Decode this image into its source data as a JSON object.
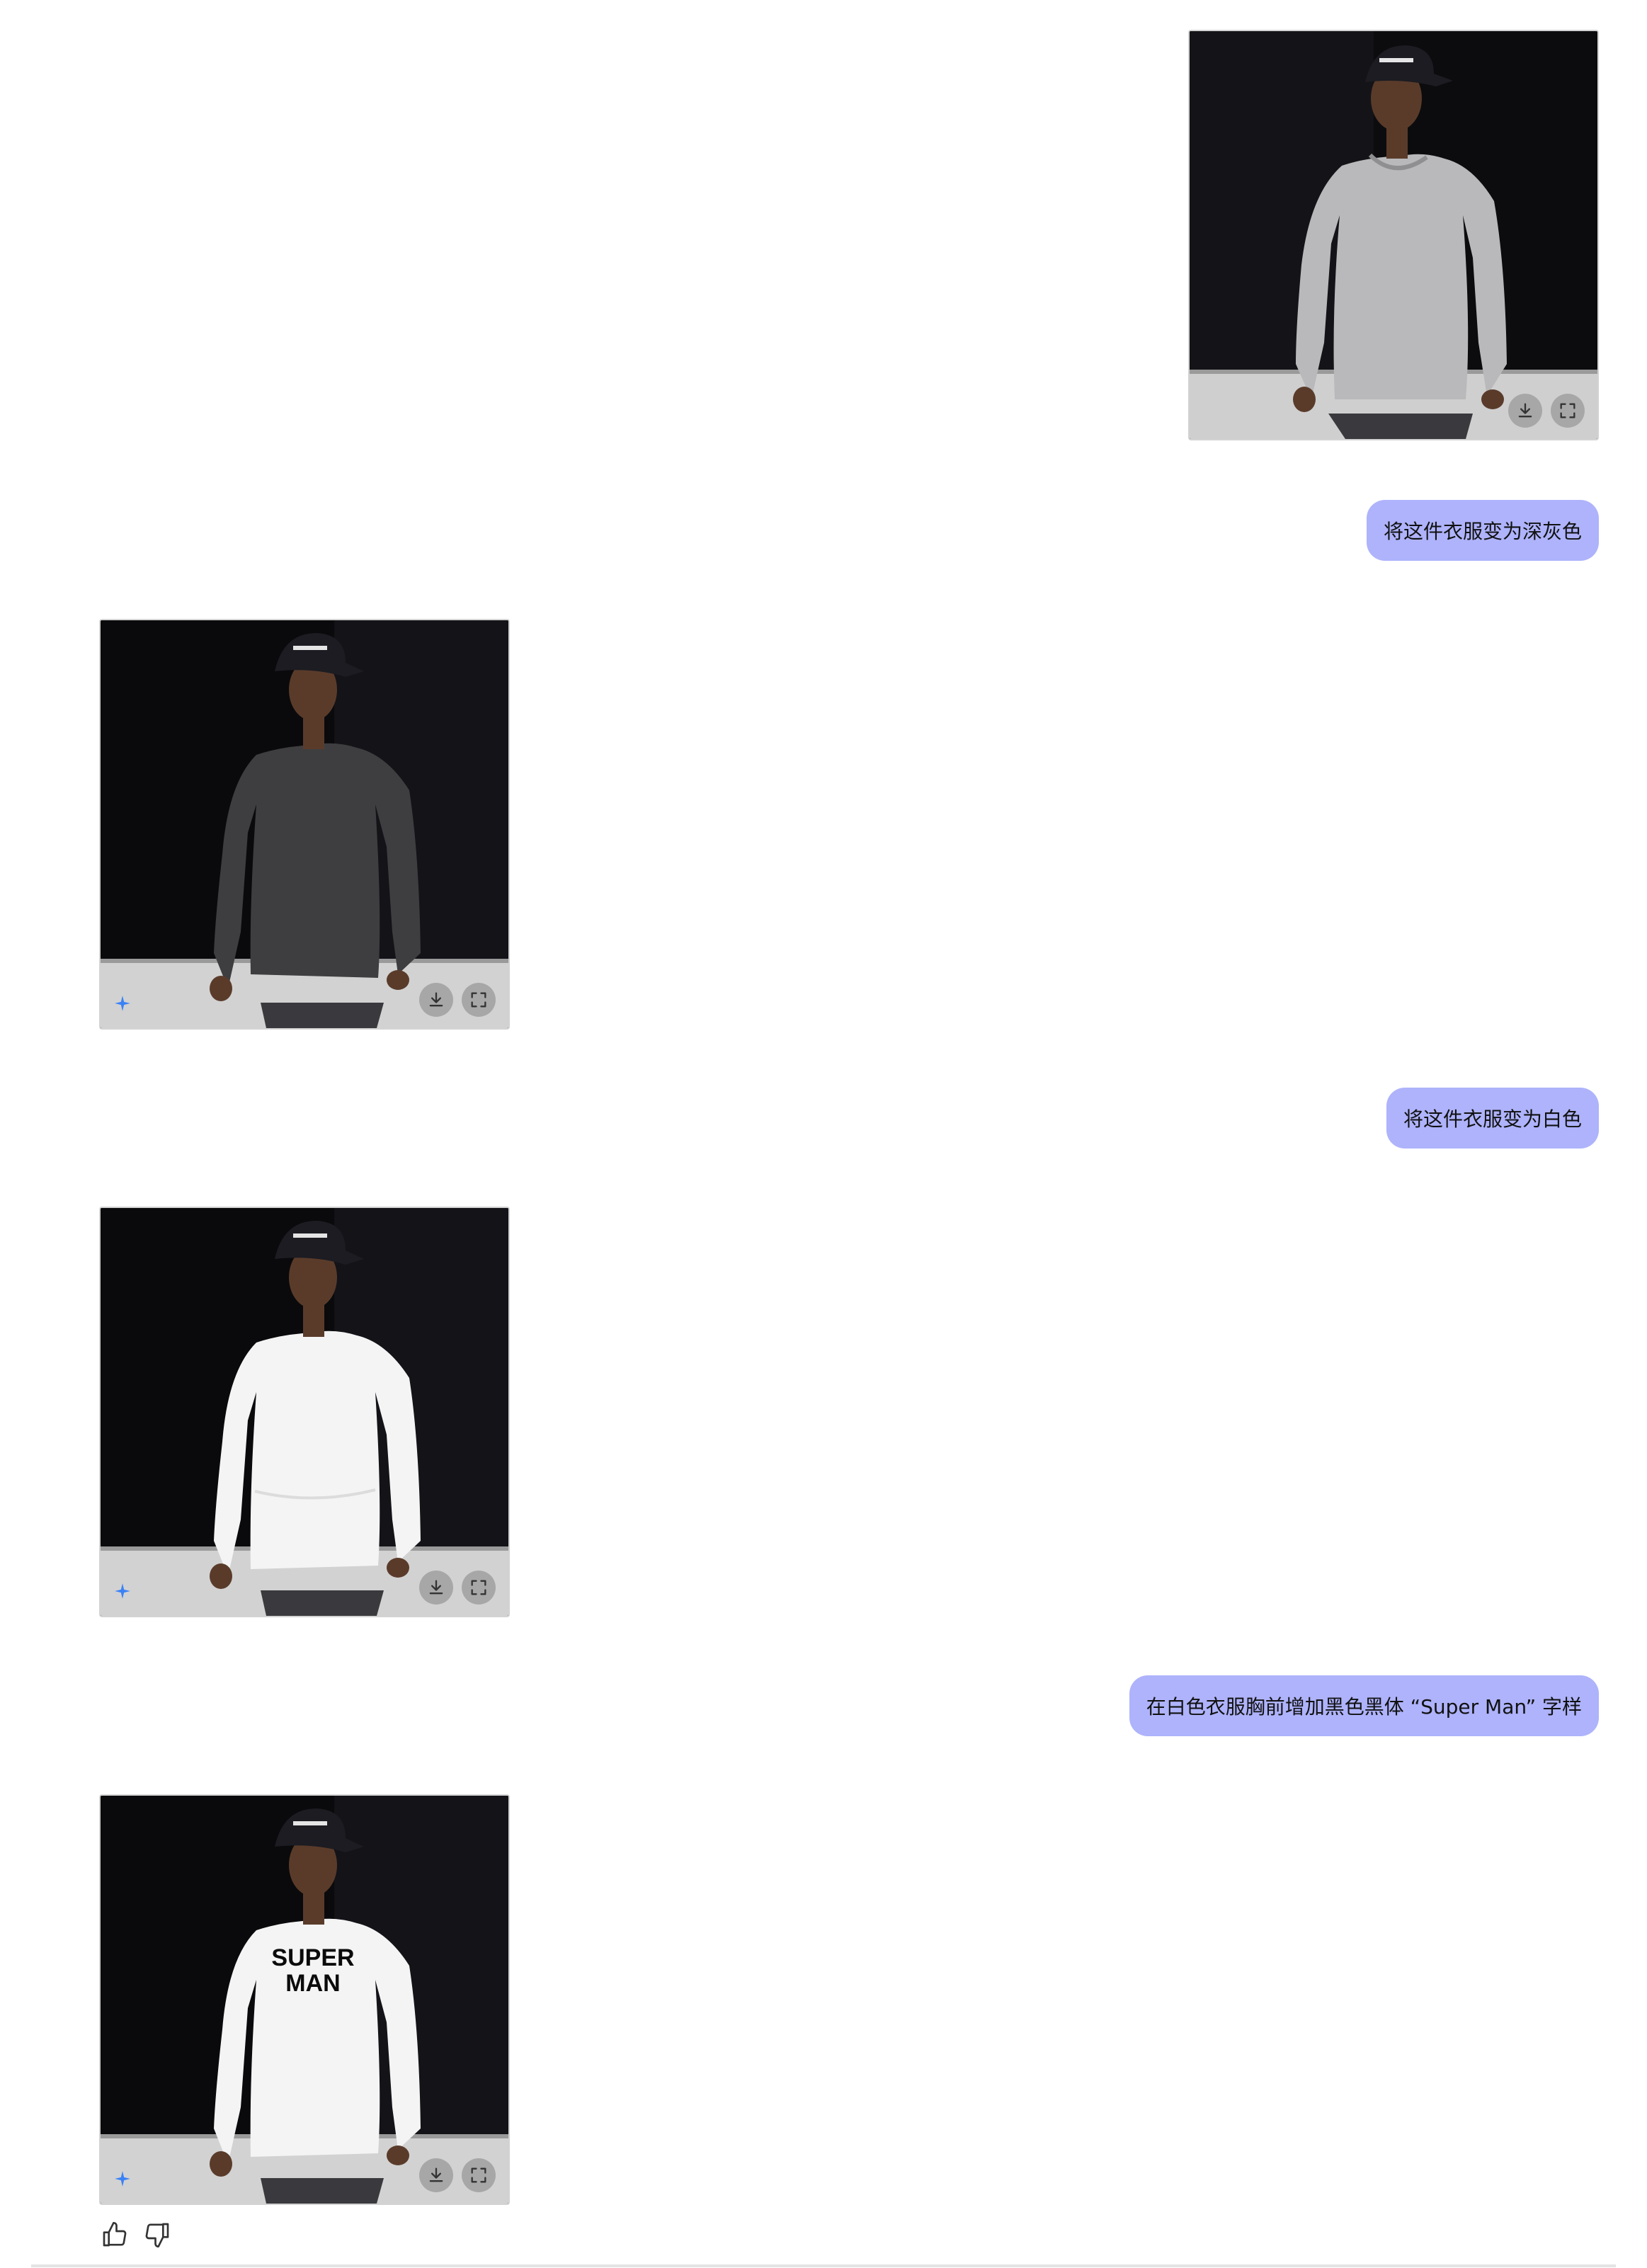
{
  "conversation": {
    "messages": [
      {
        "role": "user",
        "type": "image",
        "content": "man in light gray ribbed long-sleeve shirt and black cap"
      },
      {
        "role": "user",
        "type": "text",
        "text": "将这件衣服变为深灰色"
      },
      {
        "role": "assistant",
        "type": "image",
        "content": "same man in dark gray long-sleeve shirt"
      },
      {
        "role": "user",
        "type": "text",
        "text": "将这件衣服变为白色"
      },
      {
        "role": "assistant",
        "type": "image",
        "content": "same man in white long-sleeve shirt"
      },
      {
        "role": "user",
        "type": "text",
        "text": "在白色衣服胸前增加黑色黑体 “Super Man” 字样"
      },
      {
        "role": "assistant",
        "type": "image",
        "content": "same man in white shirt with printed text"
      }
    ]
  },
  "shirt_print": {
    "line1": "SUPER",
    "line2": "MAN"
  },
  "colors": {
    "bubble_bg": "#aeb3fb",
    "shirt_light_gray": "#b9b9bb",
    "shirt_dark_gray": "#3e3e40",
    "shirt_white": "#f4f4f4",
    "sparkle": "#3b82f6"
  },
  "icons": {
    "image_actions": [
      "download-icon",
      "expand-icon"
    ],
    "generated_badge": "sparkle-icon",
    "feedback": [
      "thumbs-up-icon",
      "thumbs-down-icon"
    ]
  }
}
